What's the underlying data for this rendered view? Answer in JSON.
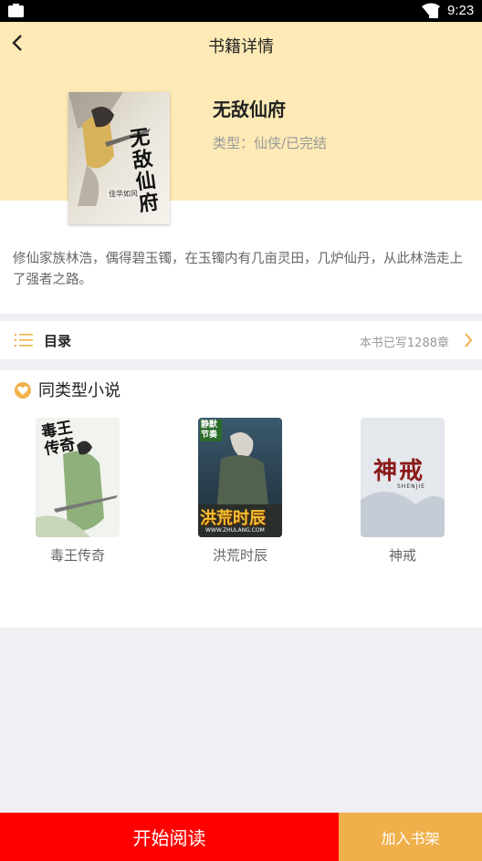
{
  "status_bar": {
    "time": "9:23"
  },
  "header": {
    "title": "书籍详情"
  },
  "book": {
    "title": "无敌仙府",
    "type": "类型：仙侠/已完结",
    "cover_text": "无敌仙府",
    "cover_author": "佳华如风"
  },
  "description": "修仙家族林浩，偶得碧玉镯，在玉镯内有几亩灵田，几炉仙丹，从此林浩走上了强者之路。",
  "toc": {
    "label": "目录",
    "count": "本书已写1288章"
  },
  "similar": {
    "title": "同类型小说",
    "books": [
      {
        "name": "毒王传奇",
        "cover_text": "毒王传奇"
      },
      {
        "name": "洪荒时辰",
        "cover_text": "洪荒时辰",
        "cover_top": "静默节奏",
        "cover_url": "WWW.ZHULANG.COM"
      },
      {
        "name": "神戒",
        "cover_text": "神戒",
        "cover_sub": "SHENJIE"
      }
    ]
  },
  "actions": {
    "read": "开始阅读",
    "shelf": "加入书架"
  }
}
